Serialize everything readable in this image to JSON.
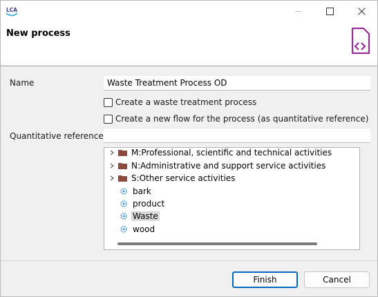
{
  "window": {
    "app_logo_text": "LCA",
    "minimize_icon": "minimize-icon",
    "maximize_icon": "maximize-icon",
    "close_icon": "close-icon"
  },
  "header": {
    "title": "New process",
    "icon": "process-wizard-icon",
    "accent_color": "#9b2d9b"
  },
  "form": {
    "name_label": "Name",
    "name_value": "Waste Treatment Process OD",
    "waste_treatment_checkbox": {
      "label": "Create a waste treatment process",
      "checked": false
    },
    "new_flow_checkbox": {
      "label": "Create a new flow for the process (as quantitative reference)",
      "checked": false
    },
    "quantitative_reference_label": "Quantitative reference",
    "quantitative_reference_value": ""
  },
  "tree": {
    "items": [
      {
        "type": "category",
        "label": "M:Professional, scientific and technical activities",
        "expanded": false
      },
      {
        "type": "category",
        "label": "N:Administrative and support service activities",
        "expanded": false
      },
      {
        "type": "category",
        "label": "S:Other service activities",
        "expanded": false
      },
      {
        "type": "flow",
        "label": "bark",
        "selected": false
      },
      {
        "type": "flow",
        "label": "product",
        "selected": false
      },
      {
        "type": "flow",
        "label": "Waste",
        "selected": true
      },
      {
        "type": "flow",
        "label": "wood",
        "selected": false
      }
    ]
  },
  "buttons": {
    "finish": "Finish",
    "cancel": "Cancel"
  }
}
